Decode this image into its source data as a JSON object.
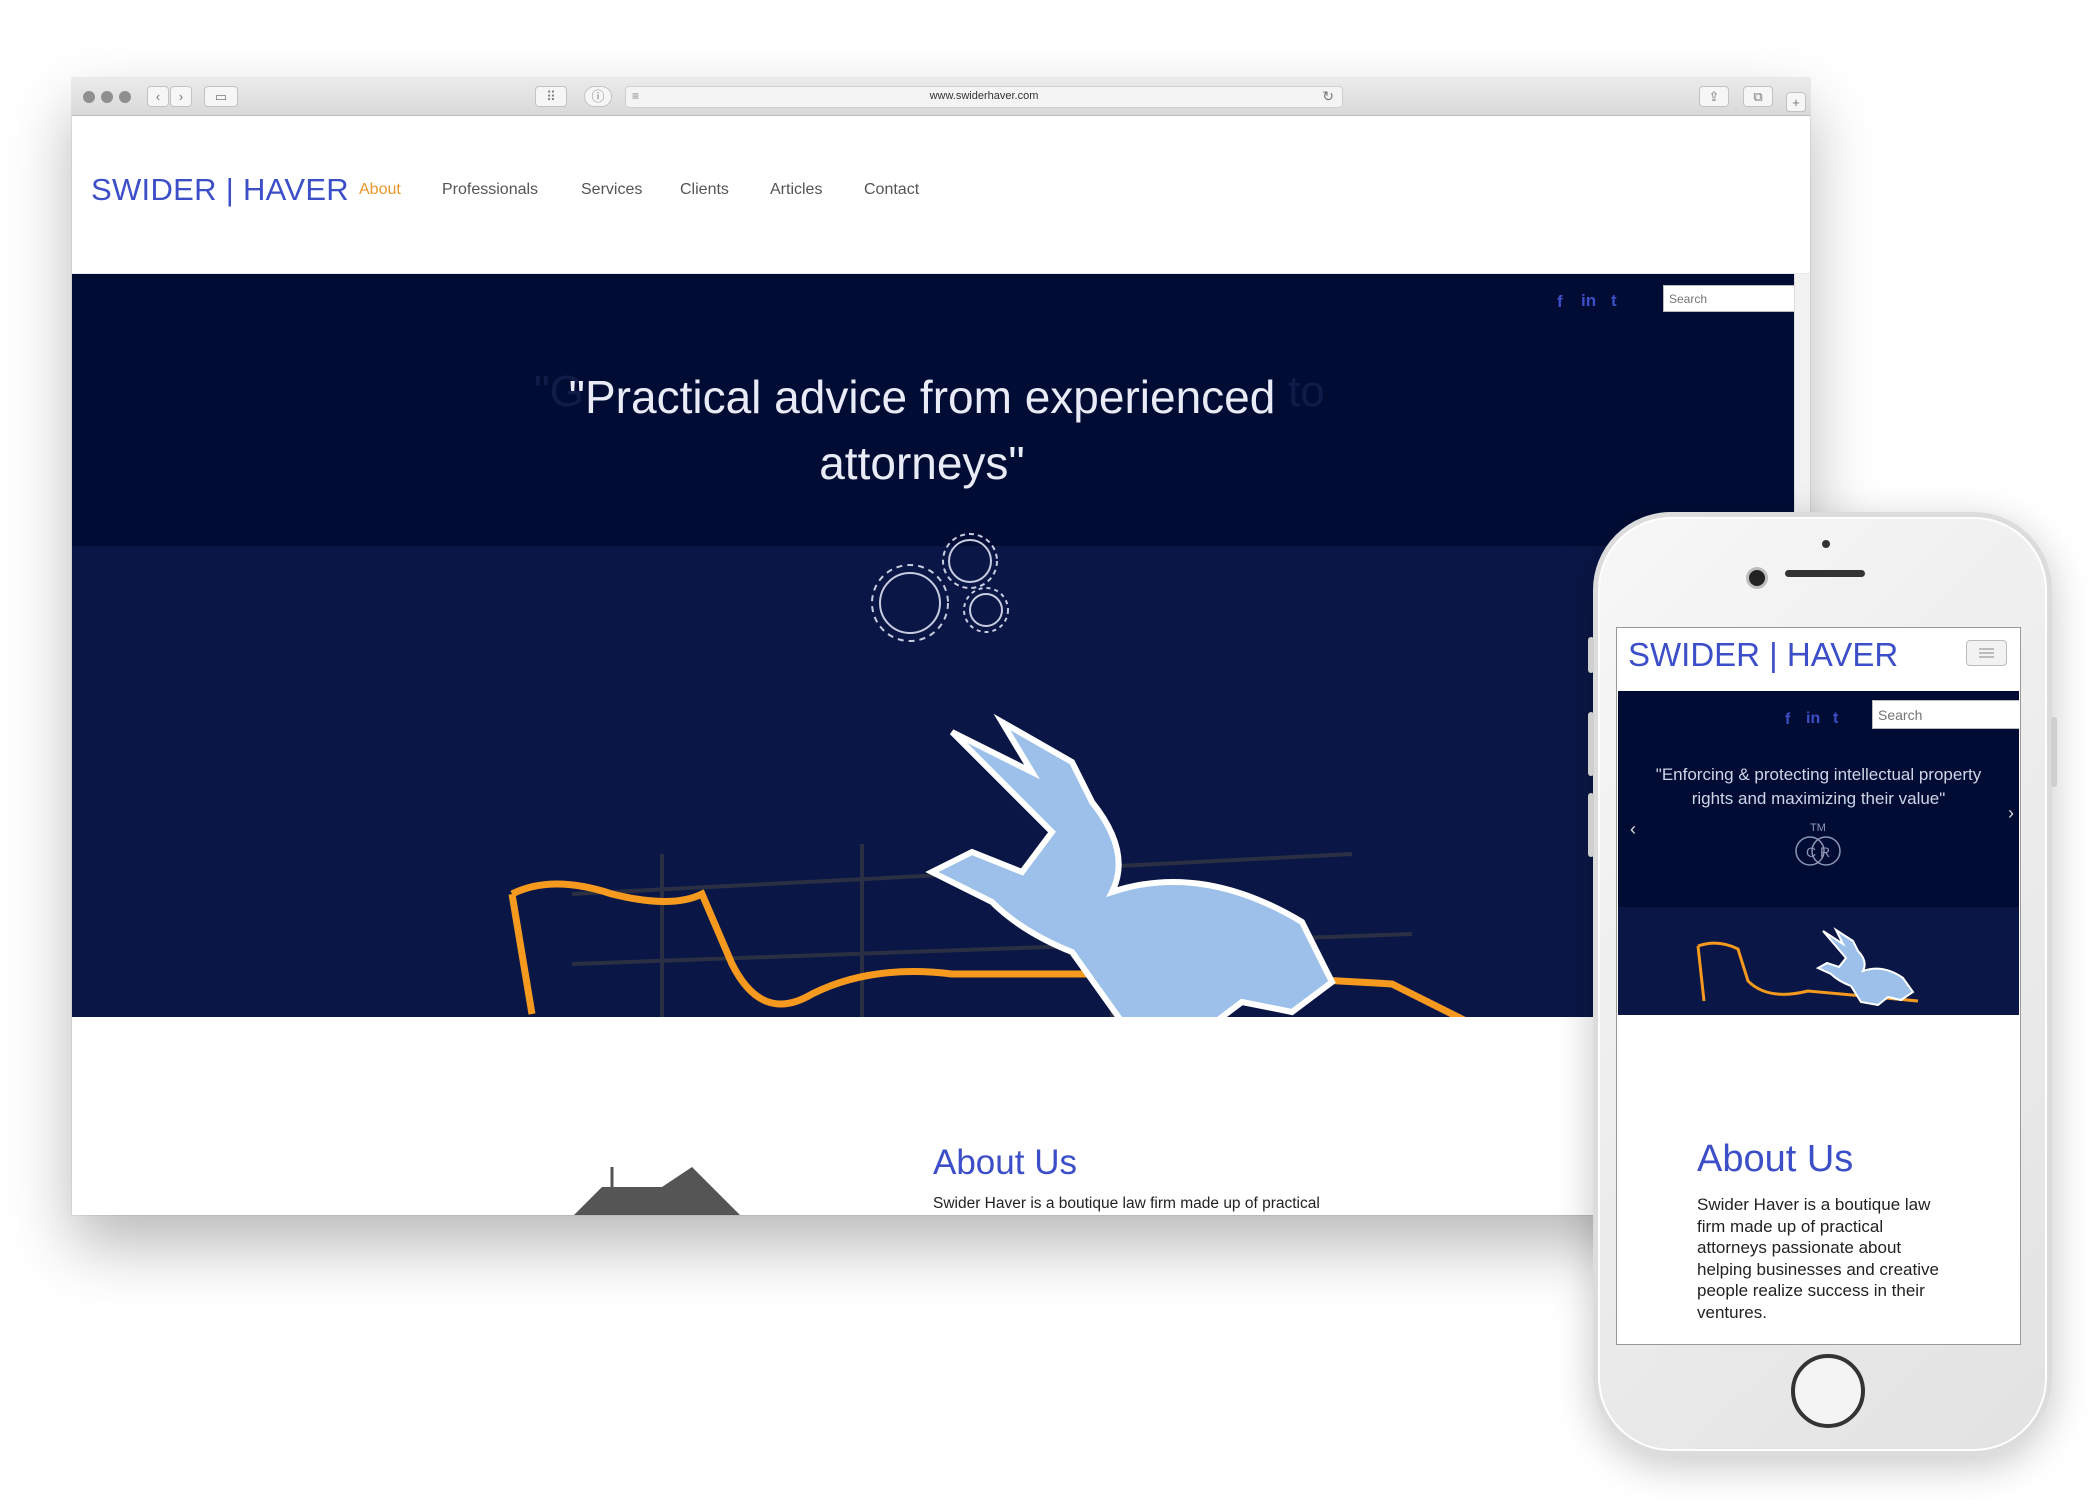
{
  "browser": {
    "url": "www.swiderhaver.com"
  },
  "site": {
    "logo": "SWIDER | HAVER",
    "nav": [
      {
        "label": "About",
        "active": true
      },
      {
        "label": "Professionals"
      },
      {
        "label": "Services"
      },
      {
        "label": "Clients"
      },
      {
        "label": "Articles"
      },
      {
        "label": "Contact"
      }
    ],
    "social": [
      "facebook-icon",
      "linkedin-icon",
      "twitter-icon"
    ],
    "social_glyphs": {
      "facebook": "f",
      "linkedin": "in",
      "twitter": "t"
    },
    "search_placeholder": "Search",
    "hero_quote_desktop": "\"Practical advice from experienced attorneys\"",
    "hero_quote_mobile": "\"Enforcing & protecting intellectual property rights and maximizing their value\"",
    "hero_badge_mobile": "TM",
    "hero_badge_mobile_2": "C R",
    "about_title": "About Us",
    "about_text_desktop": "Swider Haver is a boutique law firm made up of practical attorneys passionate about helping businesses and creative people realize success in their ventures.",
    "about_text_mobile": "Swider Haver is a boutique law firm made up of practical attorneys passionate about helping businesses and creative people realize success in their ventures."
  },
  "colors": {
    "brand_blue": "#3d4fc8",
    "nav_active": "#e8972a",
    "hero_bg": "#010c35"
  }
}
